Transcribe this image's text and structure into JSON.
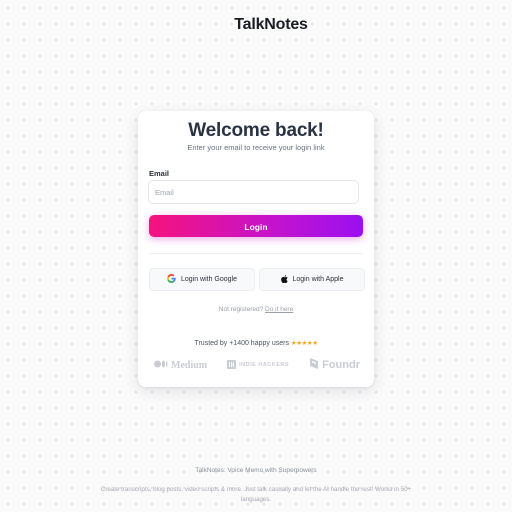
{
  "app": {
    "name": "TalkNotes",
    "logo_icon": "soundwave-icon"
  },
  "card": {
    "title": "Welcome back!",
    "subtitle": "Enter your email to receive your login link",
    "email_label": "Email",
    "email_placeholder": "Email",
    "email_value": "",
    "login_button": "Login",
    "google_button": "Login with Google",
    "apple_button": "Login with Apple",
    "not_registered": "Not registered?",
    "do_it_here": "Do it here",
    "trusted_text": "Trusted by +1400 happy users",
    "stars": "★★★★★",
    "rating": 5,
    "brands": [
      "Medium",
      "INDIE HACKERS",
      "Foundr"
    ]
  },
  "footer": {
    "title": "TalkNotes: Voice Memo with Superpowers",
    "description": "Create transcripts, blog posts, video scripts & more. Just talk casually and let the AI handle the rest! Works in 50+ languages."
  },
  "colors": {
    "gradient_start": "#f5137e",
    "gradient_end": "#9a10f0",
    "star": "#f5a623"
  }
}
